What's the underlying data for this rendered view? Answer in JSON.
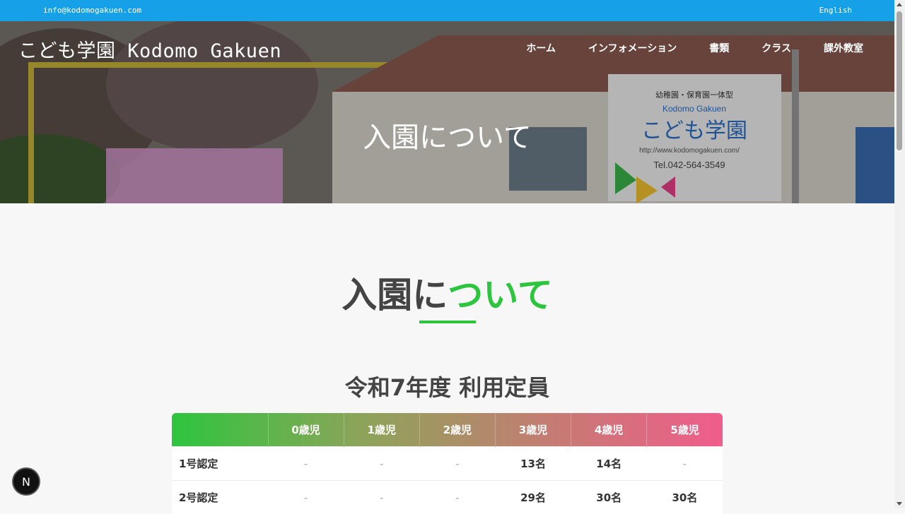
{
  "topbar": {
    "email": "info@kodomogakuen.com",
    "language": "English"
  },
  "header": {
    "brand": "こども学園 Kodomo Gakuen",
    "nav": [
      "ホーム",
      "インフォメーション",
      "書類",
      "クラス",
      "課外教室"
    ]
  },
  "hero": {
    "title": "入園について"
  },
  "section": {
    "title_main": "入園に",
    "title_accent": "ついて",
    "subtitle": "令和7年度 利用定員"
  },
  "table": {
    "headers": [
      "",
      "0歳児",
      "1歳児",
      "2歳児",
      "3歳児",
      "4歳児",
      "5歳児"
    ],
    "rows": [
      {
        "label": "1号認定",
        "cells": [
          "-",
          "-",
          "-",
          "13名",
          "14名",
          "-"
        ]
      },
      {
        "label": "2号認定",
        "cells": [
          "-",
          "-",
          "-",
          "29名",
          "30名",
          "30名"
        ]
      }
    ]
  },
  "badge": {
    "letter": "N"
  },
  "colors": {
    "topbar": "#16a0e8",
    "accent": "#2ec53e",
    "gradient_end": "#f05d8c"
  }
}
